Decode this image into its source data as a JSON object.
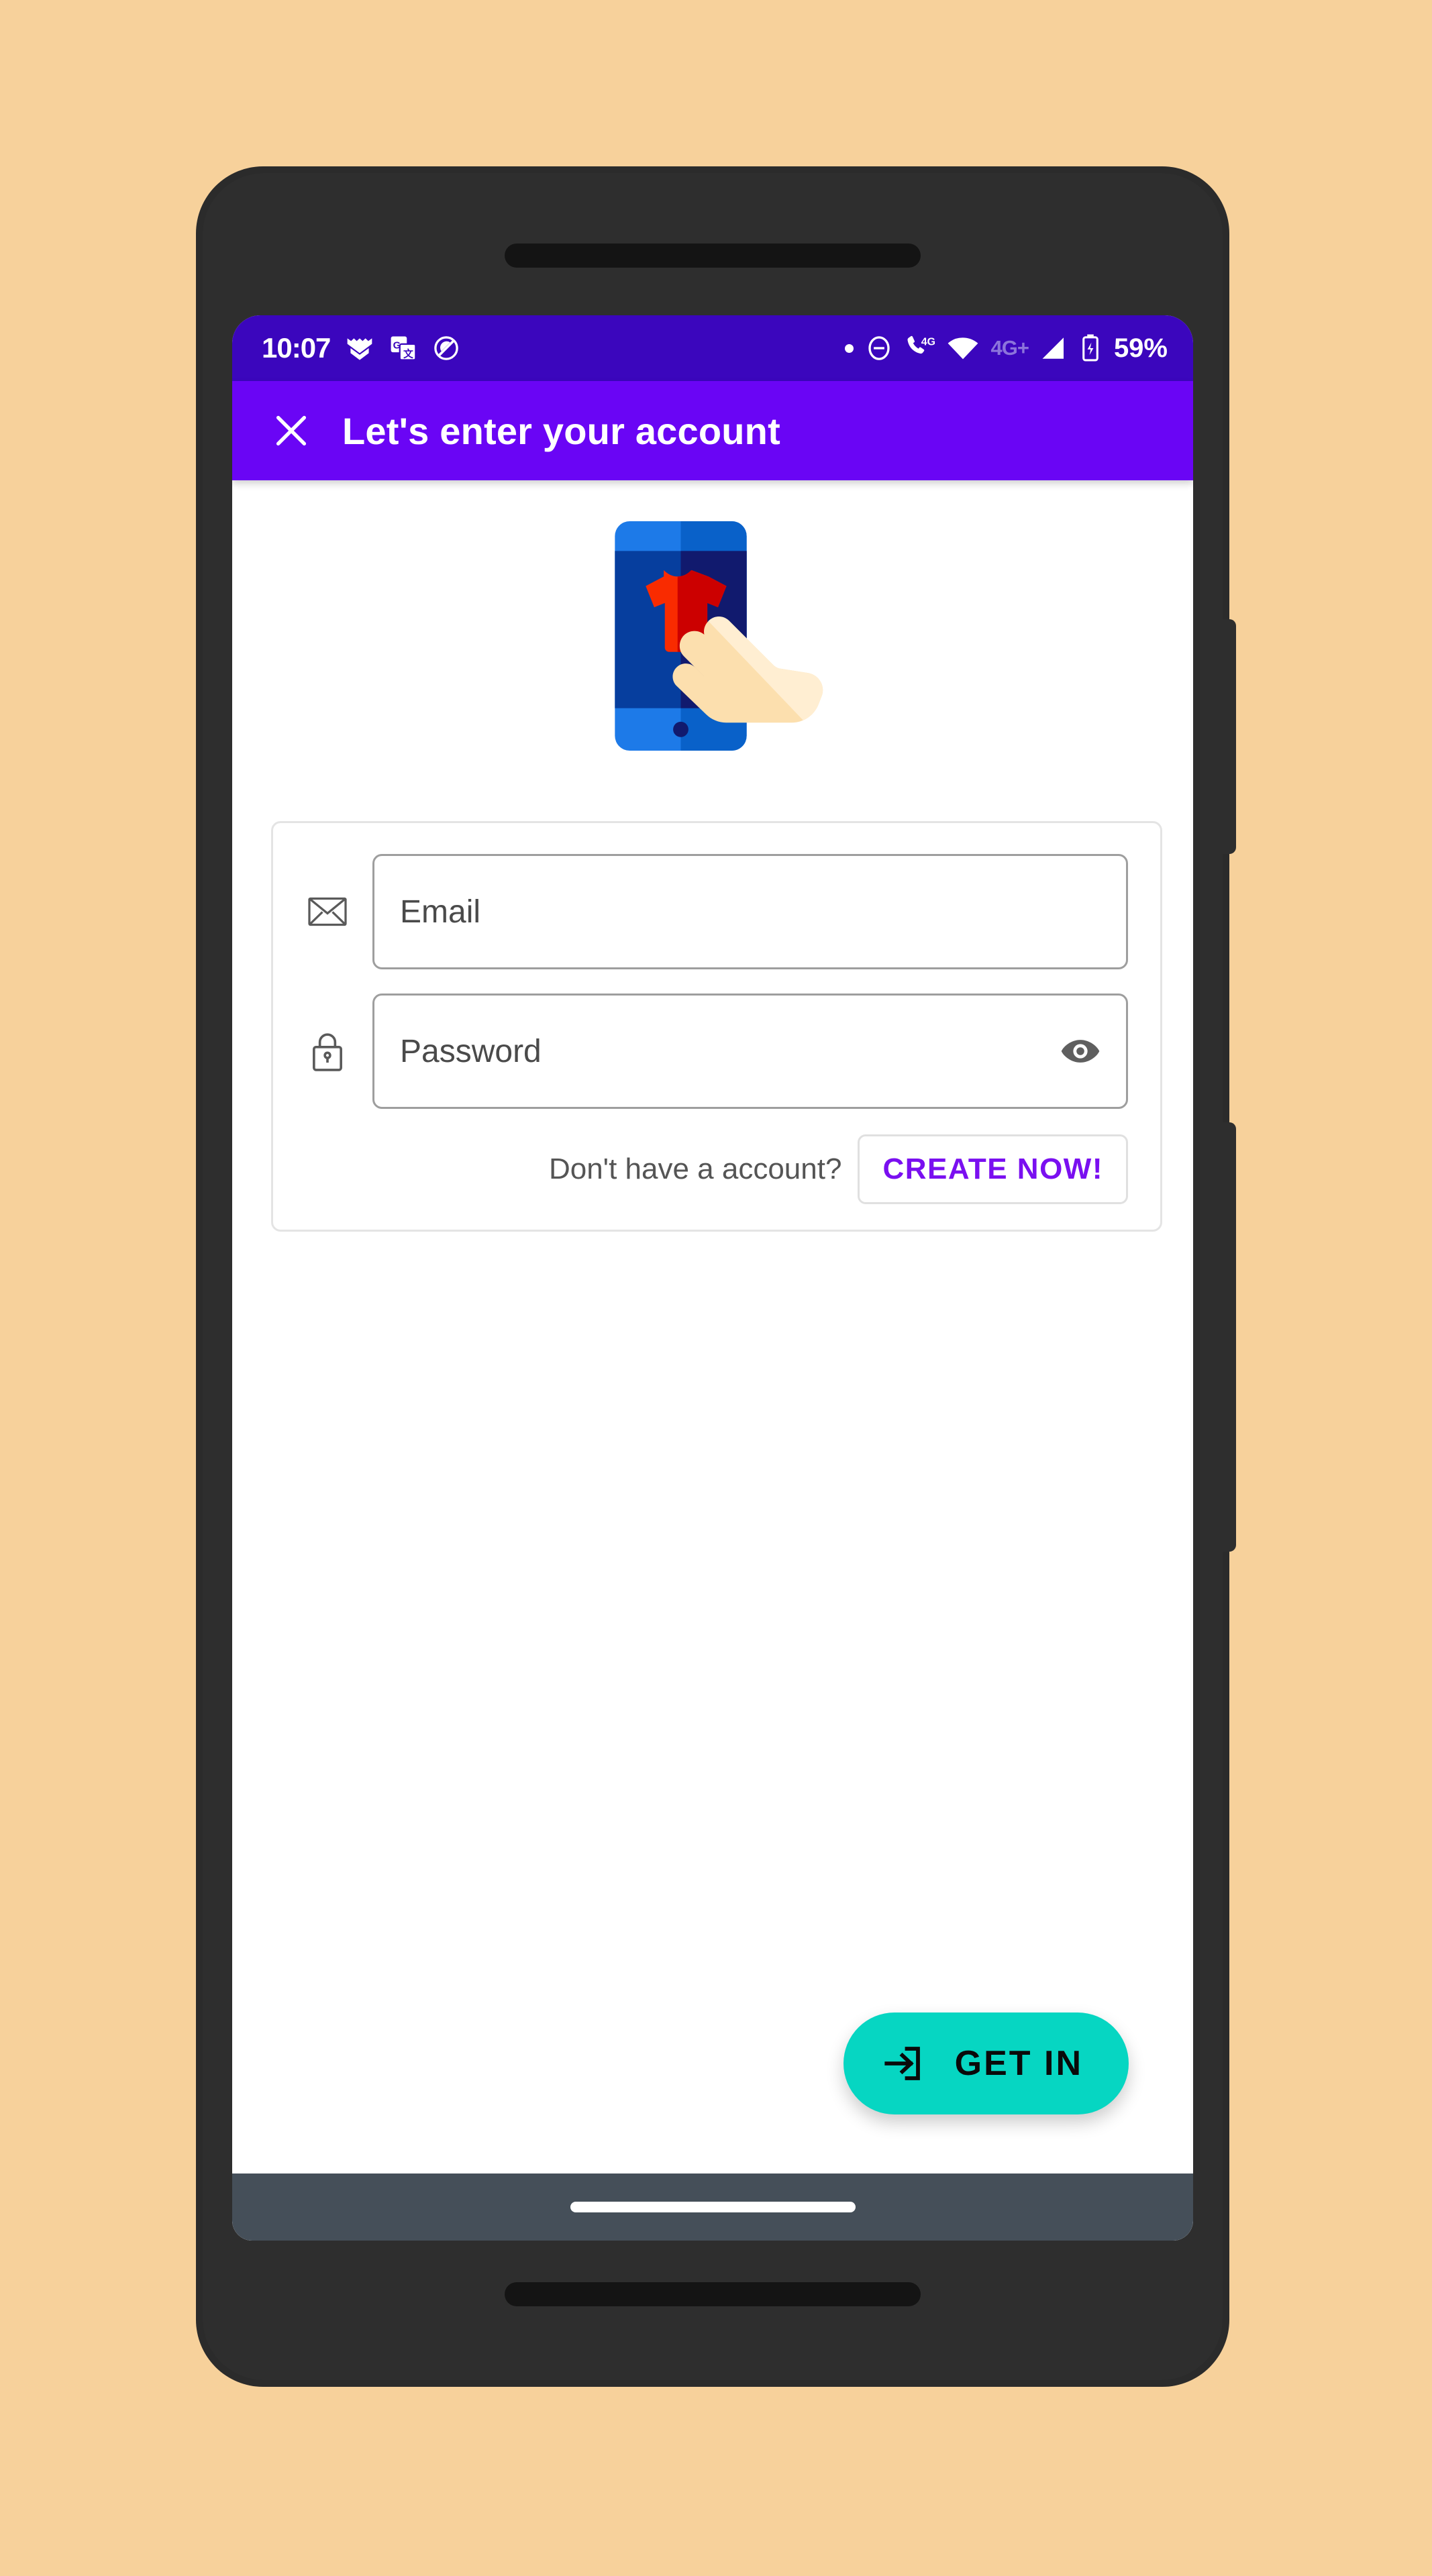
{
  "theme": {
    "page_background": "#f7d19b",
    "status_bar_color": "#3b06bd",
    "app_bar_color": "#6a05f5",
    "accent_purple": "#7a0ff0",
    "accent_teal": "#06d6c2",
    "nav_bar_color": "#454f59"
  },
  "status_bar": {
    "clock": "10:07",
    "left_icons": [
      "app-badge-icon",
      "google-translate-icon",
      "sync-disabled-icon"
    ],
    "right_icons": [
      "dot-icon",
      "do-not-disturb-icon",
      "call-4g-icon",
      "wifi-icon",
      "signal-bars-icon",
      "battery-charging-icon"
    ],
    "network_label": "4G+",
    "call_network_label": "4G",
    "battery_percent": "59%"
  },
  "app_bar": {
    "close_icon": "close-icon",
    "title": "Let's enter your account"
  },
  "illustration": {
    "name": "tap-phone-tshirt-illustration",
    "description": "Hand tapping a smartphone displaying a red t-shirt"
  },
  "form": {
    "email_field": {
      "icon": "envelope-icon",
      "placeholder": "Email",
      "value": ""
    },
    "password_field": {
      "icon": "lock-icon",
      "placeholder": "Password",
      "value": "",
      "toggle_icon": "eye-icon"
    },
    "signup_prompt": "Don't have a account?",
    "create_account_label": "CREATE NOW!"
  },
  "primary_action": {
    "icon": "login-arrow-icon",
    "label": "GET IN"
  },
  "nav_bar": {
    "gesture_pill": "gesture-home-pill"
  }
}
